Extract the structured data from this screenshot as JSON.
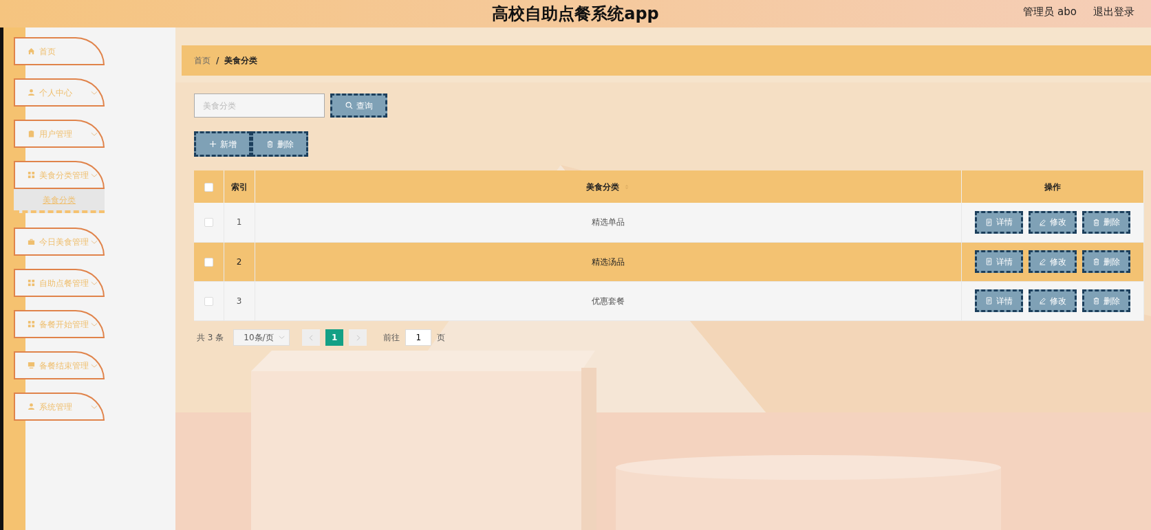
{
  "header": {
    "title": "高校自助点餐系统app",
    "user": "管理员 abo",
    "logout": "退出登录"
  },
  "sidebar": {
    "items": [
      {
        "kind": "home",
        "label": "首页",
        "expandable": false
      },
      {
        "kind": "user",
        "label": "个人中心",
        "expandable": true
      },
      {
        "kind": "clipboard",
        "label": "用户管理",
        "expandable": true
      },
      {
        "kind": "grid",
        "label": "美食分类管理",
        "expandable": true,
        "expanded": true,
        "children": [
          {
            "label": "美食分类",
            "selected": true
          }
        ]
      },
      {
        "kind": "briefcase",
        "label": "今日美食管理",
        "expandable": true
      },
      {
        "kind": "grid",
        "label": "自助点餐管理",
        "expandable": true
      },
      {
        "kind": "grid",
        "label": "备餐开始管理",
        "expandable": true
      },
      {
        "kind": "monitor",
        "label": "备餐结束管理",
        "expandable": true
      },
      {
        "kind": "user",
        "label": "系统管理",
        "expandable": true
      }
    ]
  },
  "breadcrumb": [
    "首页",
    "美食分类"
  ],
  "breadcrumb_separator": "/",
  "search": {
    "placeholder": "美食分类",
    "button": "查询"
  },
  "toolbar": [
    {
      "kind": "add",
      "label": "新增"
    },
    {
      "kind": "delete",
      "label": "删除"
    }
  ],
  "table": {
    "columns": [
      "索引",
      "美食分类",
      "操作"
    ],
    "header_checked": false,
    "rows": [
      {
        "index": "1",
        "category": "精选单品",
        "checked": false,
        "highlighted": false,
        "actions": [
          {
            "kind": "detail",
            "label": "详情"
          },
          {
            "kind": "edit",
            "label": "修改"
          },
          {
            "kind": "delete",
            "label": "删除"
          }
        ]
      },
      {
        "index": "2",
        "category": "精选汤品",
        "checked": false,
        "highlighted": true,
        "actions": [
          {
            "kind": "detail",
            "label": "详情"
          },
          {
            "kind": "edit",
            "label": "修改"
          },
          {
            "kind": "delete",
            "label": "删除"
          }
        ]
      },
      {
        "index": "3",
        "category": "优惠套餐",
        "checked": false,
        "highlighted": false,
        "actions": [
          {
            "kind": "detail",
            "label": "详情"
          },
          {
            "kind": "edit",
            "label": "修改"
          },
          {
            "kind": "delete",
            "label": "删除"
          }
        ]
      }
    ]
  },
  "pagination": {
    "total": "共 3 条",
    "page_size": "10条/页",
    "pages": [
      {
        "label": "1",
        "selected": true
      }
    ],
    "goto_label": "前往",
    "goto_value": "1",
    "page_unit": "页"
  }
}
